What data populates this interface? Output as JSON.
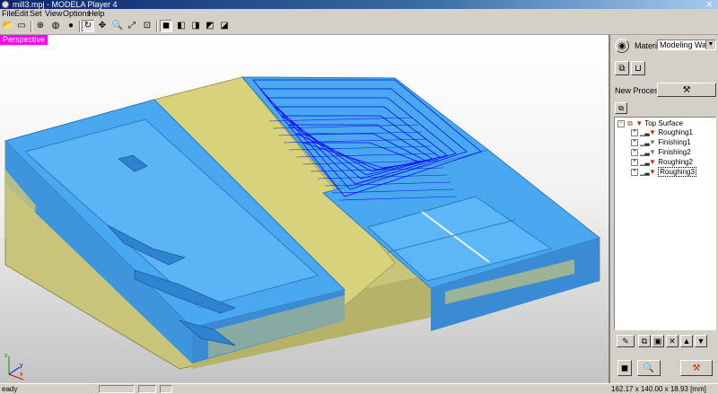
{
  "window": {
    "title": "mill3.mpj - MODELA Player 4",
    "close_label": "✕"
  },
  "menu": [
    "File",
    "Edit",
    "Set",
    "View",
    "Options",
    "Help"
  ],
  "toolbar": [
    "open-icon",
    "save-icon",
    "rotate-icon",
    "globe-icon",
    "sphere-icon",
    "refresh-icon",
    "move-icon",
    "zoom-icon",
    "fit-icon",
    "zoom-window-icon",
    "view-front-icon",
    "view-iso-icon",
    "view-side-icon",
    "view-top-icon",
    "view-back-icon"
  ],
  "viewport": {
    "label": "Perspective",
    "axes": {
      "x": "x",
      "y": "y",
      "z": "z"
    }
  },
  "panel": {
    "material_label": "Material",
    "material_value": "Modeling Wax",
    "new_process_label": "New Process",
    "tree": {
      "root": "Top Surface",
      "items": [
        "Roughing1",
        "Finishing1",
        "Finishing2",
        "Roughing2",
        "Roughing3"
      ],
      "selected": "Roughing3"
    }
  },
  "status": {
    "text": "eady",
    "dimensions": "162.17 x 140.00 x 18.93 [mm]"
  },
  "colors": {
    "part": "#4aa8f0",
    "stock": "#c8c47a",
    "toolpath": "#0a0aff",
    "viewtag": "#ff00ff"
  }
}
